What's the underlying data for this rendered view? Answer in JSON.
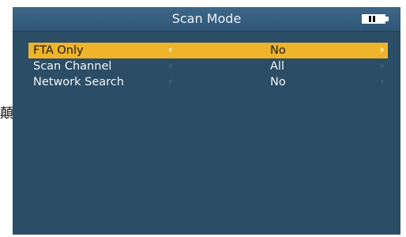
{
  "side_glyph": "顛",
  "header": {
    "title": "Scan Mode",
    "battery_icon": "battery-icon"
  },
  "menu": {
    "items": [
      {
        "label": "FTA Only",
        "value": "No",
        "left_arrow": "‹",
        "right_arrow": "›",
        "selected": true
      },
      {
        "label": "Scan Channel",
        "value": "All",
        "left_arrow": "‹",
        "right_arrow": "›",
        "selected": false
      },
      {
        "label": "Network Search",
        "value": "No",
        "left_arrow": "‹",
        "right_arrow": "›",
        "selected": false
      }
    ]
  },
  "colors": {
    "background": "#2b4d66",
    "header": "#355d7e",
    "highlight": "#f0b42b",
    "text": "#f1f5f8"
  }
}
